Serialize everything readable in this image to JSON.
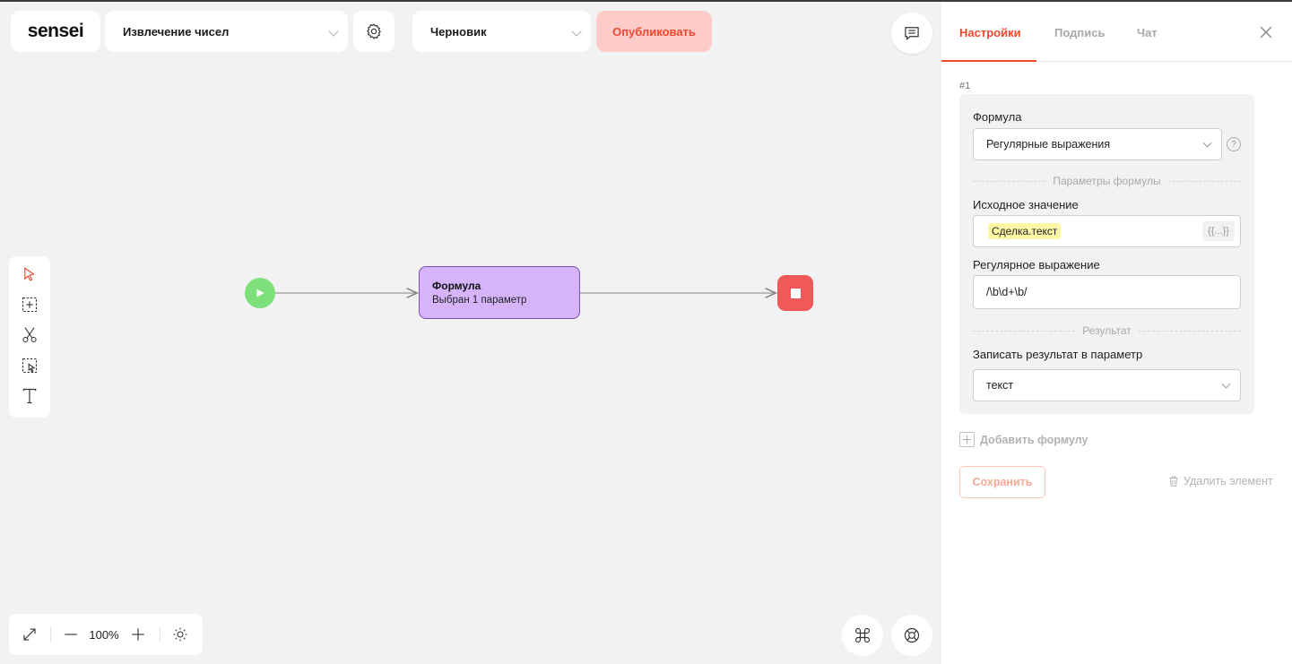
{
  "header": {
    "logo": "sensei",
    "process_name": "Извлечение чисел",
    "status": "Черновик",
    "publish_label": "Опубликовать"
  },
  "flow": {
    "node": {
      "title": "Формула",
      "subtitle": "Выбран 1 параметр"
    }
  },
  "zoom": {
    "level": "100%"
  },
  "panel": {
    "tabs": [
      {
        "label": "Настройки",
        "active": true
      },
      {
        "label": "Подпись",
        "active": false
      },
      {
        "label": "Чат",
        "active": false
      }
    ],
    "index": "#1",
    "formula_label": "Формула",
    "formula_value": "Регулярные выражения",
    "params_divider": "Параметры формулы",
    "source_label": "Исходное значение",
    "source_tag": "Сделка.текст",
    "var_button": "{{...}}",
    "regex_label": "Регулярное выражение",
    "regex_value": "/\\b\\d+\\b/",
    "result_divider": "Результат",
    "write_label": "Записать результат в параметр",
    "write_value": "текст",
    "add_formula": "Добавить формулу",
    "save": "Сохранить",
    "delete": "Удалить элемент"
  },
  "colors": {
    "accent": "#f0482f",
    "start": "#7ee07b",
    "stop": "#f2575a",
    "node": "#d6b4fb",
    "publish_bg": "#fdcbc8",
    "tag_bg": "#fdf7a5"
  }
}
